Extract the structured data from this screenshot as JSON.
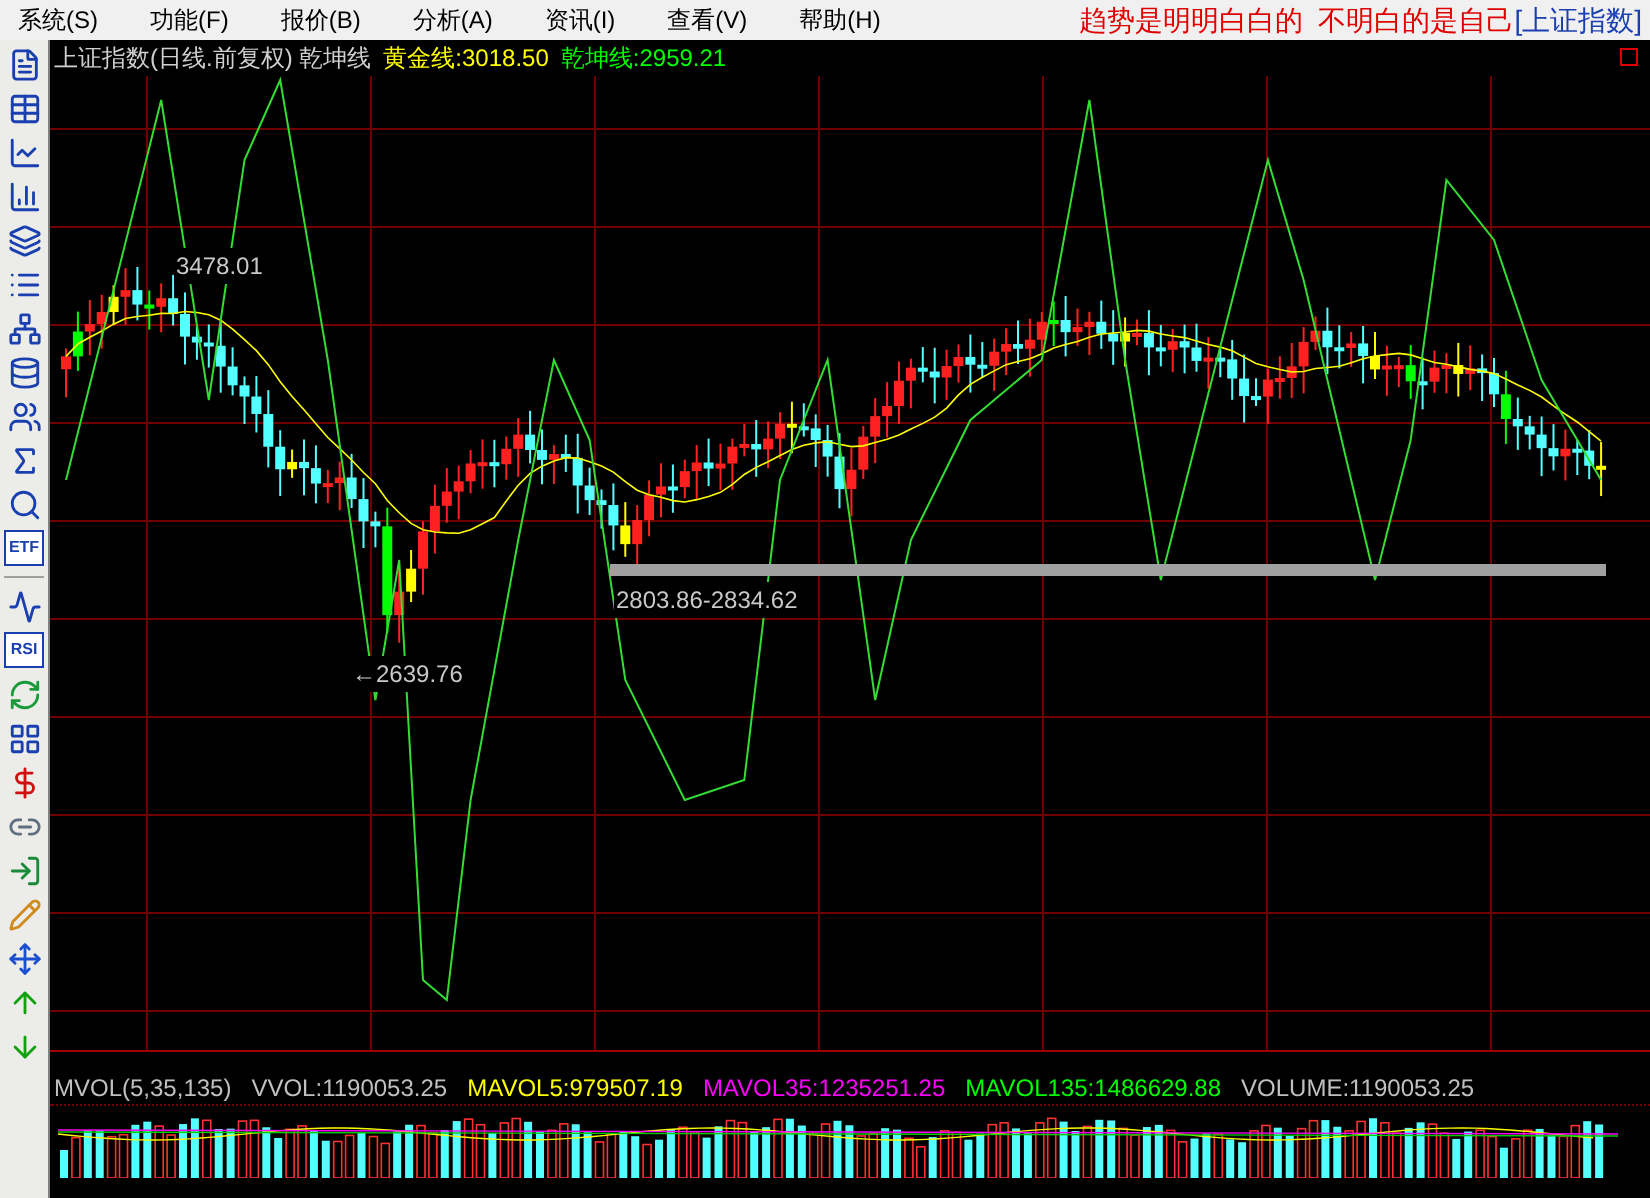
{
  "menu": [
    {
      "label": "系统(S)"
    },
    {
      "label": "功能(F)"
    },
    {
      "label": "报价(B)"
    },
    {
      "label": "分析(A)"
    },
    {
      "label": "资讯(I)"
    },
    {
      "label": "查看(V)"
    },
    {
      "label": "帮助(H)"
    }
  ],
  "slogan": "趋势是明明白白的  不明白的是自己",
  "index_link": "[上证指数]",
  "toolbar": [
    [
      {
        "kind": "icon"
      },
      {
        "kind": "icon"
      },
      {
        "kind": "icon"
      },
      {
        "kind": "icon"
      },
      {
        "kind": "icon"
      },
      {
        "kind": "icon"
      },
      {
        "kind": "icon"
      },
      {
        "kind": "icon"
      },
      {
        "kind": "icon"
      },
      {
        "kind": "icon"
      },
      {
        "kind": "icon"
      },
      {
        "kind": "text",
        "label": "ETF"
      }
    ],
    [
      {
        "kind": "icon"
      },
      {
        "kind": "text",
        "label": "RSI"
      },
      {
        "kind": "icon"
      },
      {
        "kind": "icon"
      },
      {
        "kind": "icon"
      },
      {
        "kind": "icon"
      },
      {
        "kind": "icon"
      },
      {
        "kind": "icon"
      },
      {
        "kind": "icon"
      },
      {
        "kind": "icon"
      },
      {
        "kind": "icon"
      }
    ]
  ],
  "chart": {
    "title": "上证指数(日线.前复权) 乾坤线",
    "indicators": [
      {
        "label": "黄金线:3018.50",
        "color": "#ffff00"
      },
      {
        "label": "乾坤线:2959.21",
        "color": "#00ff00"
      }
    ],
    "annotations": [
      {
        "kind": "high",
        "text": "3478.01"
      },
      {
        "kind": "low",
        "text": "←2639.76"
      },
      {
        "kind": "range",
        "text": "2803.86-2834.62"
      }
    ]
  },
  "volume": {
    "legend": [
      {
        "label": "MVOL(5,35,135)",
        "color": "#c0c0c0"
      },
      {
        "label": "VVOL:1190053.25",
        "color": "#c0c0c0"
      },
      {
        "label": "MAVOL5:979507.19",
        "color": "#ffff00"
      },
      {
        "label": "MAVOL35:1235251.25",
        "color": "#ff00ff"
      },
      {
        "label": "MAVOL135:1486629.88",
        "color": "#00ff00"
      },
      {
        "label": "VOLUME:1190053.25",
        "color": "#c0c0c0"
      }
    ]
  }
}
